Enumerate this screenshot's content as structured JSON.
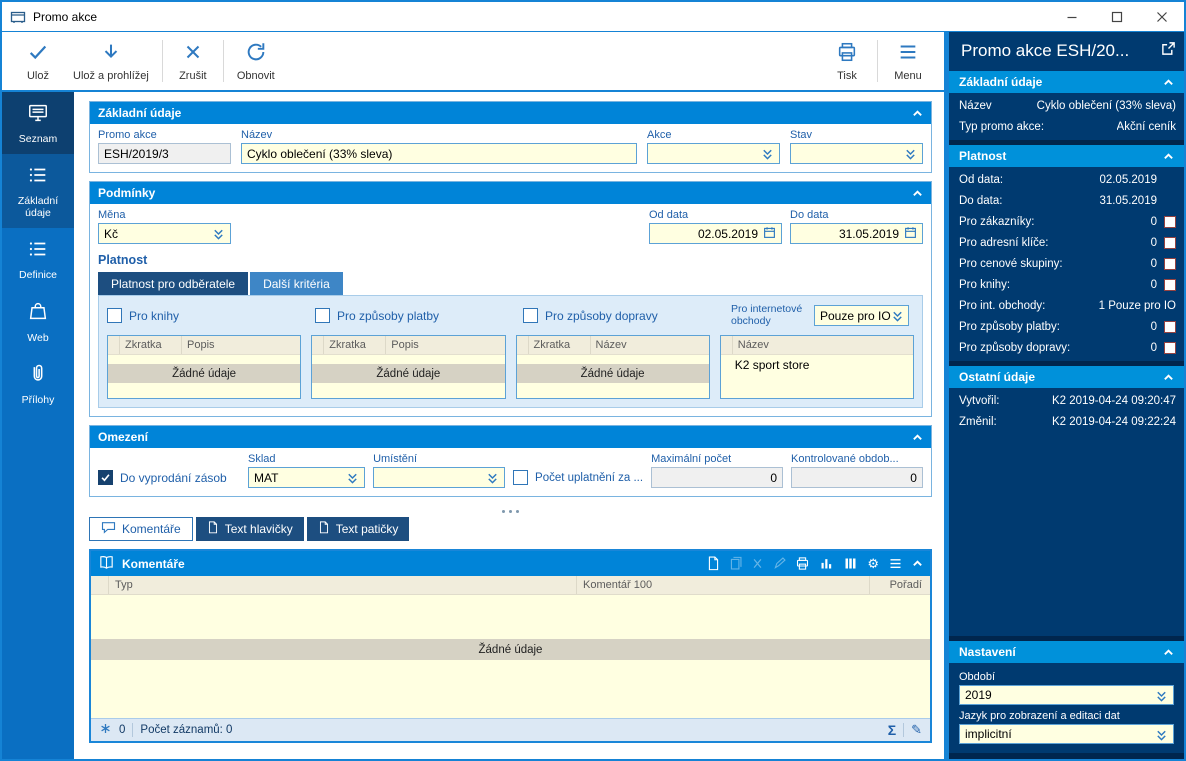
{
  "colors": {
    "accent": "#1583d5",
    "section_header": "#0084d8",
    "panel_navy": "#003a70",
    "panel_header": "#0091da",
    "field_yellow": "#ffffe1",
    "icon_blue": "#2e79c0"
  },
  "window": {
    "title": "Promo akce"
  },
  "toolbar": {
    "save": "Ulož",
    "save_and_view": "Ulož a prohlížej",
    "cancel": "Zrušit",
    "refresh": "Obnovit",
    "print": "Tisk",
    "menu": "Menu"
  },
  "sidebar": {
    "items": [
      {
        "label": "Seznam"
      },
      {
        "label": "Základní údaje"
      },
      {
        "label": "Definice"
      },
      {
        "label": "Web"
      },
      {
        "label": "Přílohy"
      }
    ]
  },
  "basic": {
    "title": "Základní údaje",
    "promo_label": "Promo akce",
    "promo_value": "ESH/2019/3",
    "name_label": "Název",
    "name_value": "Cyklo oblečení (33% sleva)",
    "action_label": "Akce",
    "action_value": "",
    "state_label": "Stav",
    "state_value": ""
  },
  "conditions": {
    "title": "Podmínky",
    "currency_label": "Měna",
    "currency_value": "Kč",
    "from_label": "Od data",
    "from_value": "02.05.2019",
    "to_label": "Do data",
    "to_value": "31.05.2019",
    "validity_title": "Platnost",
    "tab_customers": "Platnost pro odběratele",
    "tab_other": "Další kritéria",
    "cb_books": "Pro knihy",
    "cb_books_checked": false,
    "cb_payment": "Pro způsoby platby",
    "cb_payment_checked": false,
    "cb_transport": "Pro způsoby dopravy",
    "cb_transport_checked": false,
    "internet_label": "Pro internetové obchody",
    "internet_value": "Pouze pro IO",
    "tables": [
      {
        "cols": [
          "Zkratka",
          "Popis"
        ],
        "empty": "Žádné údaje"
      },
      {
        "cols": [
          "Zkratka",
          "Popis"
        ],
        "empty": "Žádné údaje"
      },
      {
        "cols": [
          "Zkratka",
          "Název"
        ],
        "empty": "Žádné údaje"
      },
      {
        "cols": [
          "Název"
        ],
        "row": "K2 sport store"
      }
    ]
  },
  "limits": {
    "title": "Omezení",
    "sellout_label": "Do vyprodání zásob",
    "sellout_checked": true,
    "warehouse_label": "Sklad",
    "warehouse_value": "MAT",
    "location_label": "Umístění",
    "location_value": "",
    "usage_label": "Počet uplatnění za ...",
    "usage_checked": false,
    "max_label": "Maximální počet",
    "max_value": "0",
    "period_label": "Kontrolované obdob...",
    "period_value": "0"
  },
  "bottom_tabs": {
    "comments": "Komentáře",
    "header_text": "Text hlavičky",
    "footer_text": "Text patičky"
  },
  "comments": {
    "title": "Komentáře",
    "col_type": "Typ",
    "col_comment": "Komentář 100",
    "col_order": "Pořadí",
    "empty": "Žádné údaje",
    "lock_count": "0",
    "records": "Počet záznamů: 0"
  },
  "right_panel": {
    "title": "Promo akce ESH/20...",
    "basic": {
      "title": "Základní údaje",
      "rows": [
        {
          "label": "Název",
          "value": "Cyklo oblečení (33% sleva)"
        },
        {
          "label": "Typ promo akce:",
          "value": "Akční ceník"
        }
      ]
    },
    "validity": {
      "title": "Platnost",
      "rows": [
        {
          "label": "Od data:",
          "value": "02.05.2019"
        },
        {
          "label": "Do data:",
          "value": "31.05.2019"
        },
        {
          "label": "Pro zákazníky:",
          "value": "0"
        },
        {
          "label": "Pro adresní klíče:",
          "value": "0"
        },
        {
          "label": "Pro cenové skupiny:",
          "value": "0"
        },
        {
          "label": "Pro knihy:",
          "value": "0"
        },
        {
          "label": "Pro int. obchody:",
          "value": "1 Pouze pro IO"
        },
        {
          "label": "Pro způsoby platby:",
          "value": "0"
        },
        {
          "label": "Pro způsoby dopravy:",
          "value": "0"
        }
      ]
    },
    "other": {
      "title": "Ostatní údaje",
      "rows": [
        {
          "label": "Vytvořil:",
          "value": "K2 2019-04-24 09:20:47"
        },
        {
          "label": "Změnil:",
          "value": "K2 2019-04-24 09:22:24"
        }
      ]
    },
    "settings": {
      "title": "Nastavení",
      "period_label": "Období",
      "period_value": "2019",
      "lang_label": "Jazyk pro zobrazení a editaci dat",
      "lang_value": "implicitní"
    }
  },
  "icons": {
    "sigma": "Σ",
    "pencil": "✎",
    "gear": "⚙"
  }
}
